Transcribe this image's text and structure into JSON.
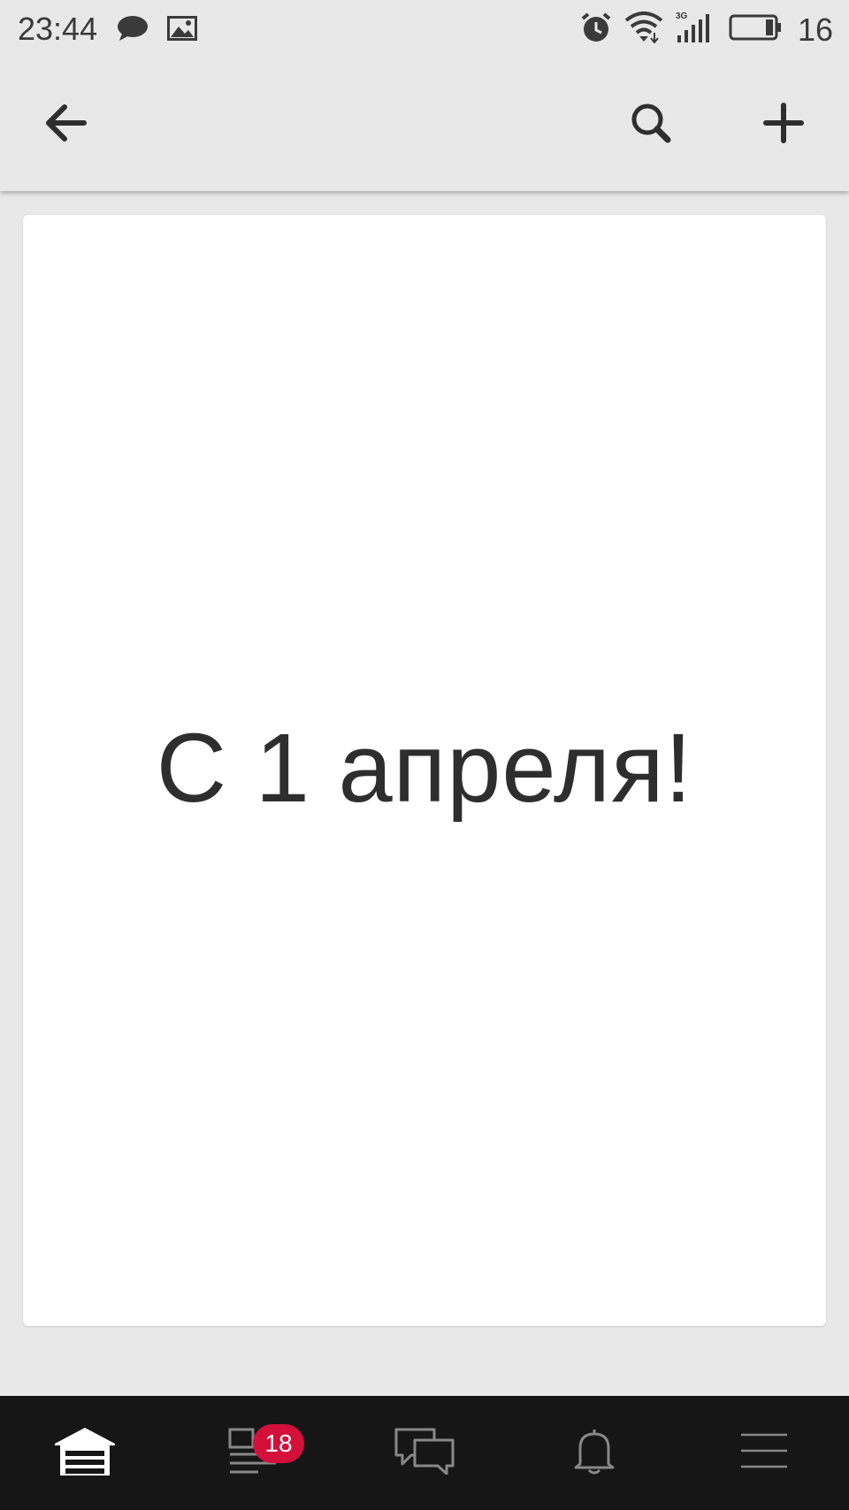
{
  "status_bar": {
    "time": "23:44",
    "battery_percent": "16",
    "network": "3G",
    "icons": [
      "chat-bubble-icon",
      "image-icon",
      "alarm-icon",
      "wifi-icon",
      "signal-icon",
      "battery-icon"
    ]
  },
  "toolbar": {
    "back_icon": "arrow-left-icon",
    "search_icon": "search-icon",
    "add_icon": "plus-icon"
  },
  "content": {
    "card_text": "С 1 апреля!"
  },
  "bottom_nav": {
    "items": [
      {
        "icon": "garage-icon",
        "active": true
      },
      {
        "icon": "feed-icon",
        "badge": "18"
      },
      {
        "icon": "messages-icon"
      },
      {
        "icon": "bell-icon"
      },
      {
        "icon": "menu-icon"
      }
    ]
  },
  "colors": {
    "background": "#e8e8e8",
    "card": "#ffffff",
    "nav_background": "#161616",
    "badge": "#d3103a"
  }
}
